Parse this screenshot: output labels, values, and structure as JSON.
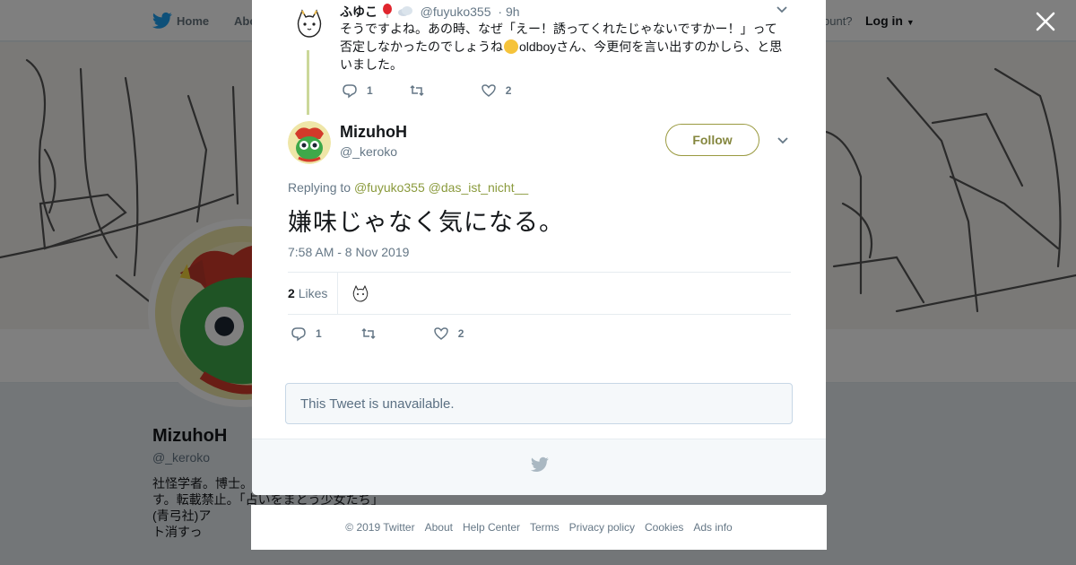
{
  "background": {
    "topbar": {
      "home": "Home",
      "about": "Abo",
      "account_text": "ccount?",
      "login": "Log in"
    },
    "profile": {
      "name": "MizuhoH",
      "handle": "@_keroko",
      "bio": "社怪学者。博士。　　　　　　　　　います。転載禁止。「占いをまとう少女たち」(青弓社)ア　　　　　　　　　　らツイート消すっ"
    }
  },
  "modal": {
    "parent_tweet": {
      "name": "ふゆこ",
      "handle": "@fuyuko355",
      "time": "· 9h",
      "text_before": "そうですよね。あの時、なぜ「えー！誘ってくれたじゃないですかー！」って否定しなかったのでしょうね",
      "text_after": "oldboyさん、今更何を言い出すのかしら、と思いました。",
      "reply_count": "1",
      "like_count": "2"
    },
    "main_tweet": {
      "name": "MizuhoH",
      "handle": "@_keroko",
      "follow_label": "Follow",
      "replying_prefix": "Replying to",
      "replying_to_1": "@fuyuko355",
      "replying_to_2": "@das_ist_nicht__",
      "text": "嫌味じゃなく気になる。",
      "timestamp": "7:58 AM - 8 Nov 2019",
      "likes_count": "2",
      "likes_label": "Likes",
      "reply_count": "1",
      "like_count": "2"
    },
    "unavailable_text": "This Tweet is unavailable."
  },
  "footer": {
    "copyright": "© 2019 Twitter",
    "about": "About",
    "help": "Help Center",
    "terms": "Terms",
    "privacy": "Privacy policy",
    "cookies": "Cookies",
    "ads": "Ads info"
  },
  "colors": {
    "accent": "#8a9a3c",
    "follow_border": "#9a9a40",
    "twitter_blue": "#1da1f2"
  },
  "icons": [
    "twitter-bird-icon",
    "close-icon",
    "chevron-down-icon",
    "reply-icon",
    "retweet-icon",
    "like-icon",
    "balloon-emoji-icon",
    "cloud-emoji-icon",
    "thinking-emoji-icon"
  ]
}
